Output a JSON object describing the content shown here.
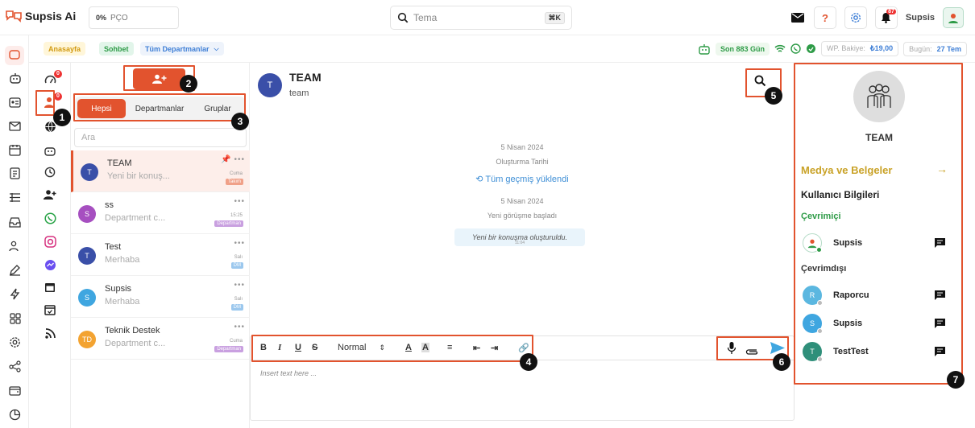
{
  "app": {
    "name": "Supsis Ai"
  },
  "top": {
    "progress_pct": "0%",
    "progress_label": "PÇO",
    "search_value": "Tema",
    "search_shortcut": "⌘K",
    "notif_count": "87",
    "user_name": "Supsis"
  },
  "subbar": {
    "home": "Anasayfa",
    "chat": "Sohbet",
    "dept_select": "Tüm Departmanlar",
    "days": "Son 883 Gün",
    "wp_label": "WP. Bakiye:",
    "wp_value": "₺19,00",
    "today_label": "Bugün:",
    "today_value": "27 Tem"
  },
  "nav_badges": {
    "a": "0",
    "b": "0"
  },
  "list": {
    "tabs": [
      "Hepsi",
      "Departmanlar",
      "Gruplar"
    ],
    "search_placeholder": "Ara",
    "conversations": [
      {
        "initial": "T",
        "name": "TEAM",
        "preview": "Yeni bir konuş...",
        "time": "Cuma",
        "tag": "Takım",
        "color": "#3a4fa8",
        "tag_color": "#f0a088",
        "selected": true
      },
      {
        "initial": "S",
        "name": "ss",
        "preview": "Department c...",
        "time": "15:25",
        "tag": "Departman",
        "color": "#a64fc0",
        "tag_color": "#c9a0e0"
      },
      {
        "initial": "T",
        "name": "Test",
        "preview": "Merhaba",
        "time": "Salı",
        "tag": "DM",
        "color": "#3a4fa8",
        "tag_color": "#9cc8ee"
      },
      {
        "initial": "S",
        "name": "Supsis",
        "preview": "Merhaba",
        "time": "Salı",
        "tag": "DM",
        "color": "#3fa6e0",
        "tag_color": "#9cc8ee"
      },
      {
        "initial": "TD",
        "name": "Teknik Destek",
        "preview": "Department c...",
        "time": "Cuma",
        "tag": "Departman",
        "color": "#f3a331",
        "tag_color": "#c9a0e0"
      }
    ]
  },
  "chat": {
    "initial": "T",
    "title": "TEAM",
    "subtitle": "team",
    "date1": "5 Nisan 2024",
    "created": "Oluşturma Tarihi",
    "history": "Tüm geçmiş yüklendi",
    "date2": "5 Nisan 2024",
    "started": "Yeni görüşme başladı",
    "bubble": "Yeni bir konuşma oluşturuldu.",
    "bubble_time": "11:04",
    "editor": {
      "style": "Normal",
      "placeholder": "Insert text here ..."
    }
  },
  "right": {
    "title": "TEAM",
    "media": "Medya ve Belgeler",
    "users": "Kullanıcı Bilgileri",
    "online": "Çevrimiçi",
    "offline": "Çevrimdışı",
    "online_users": [
      {
        "name": "Supsis"
      }
    ],
    "offline_users": [
      {
        "initial": "R",
        "name": "Raporcu",
        "color": "#5bb7e0"
      },
      {
        "initial": "S",
        "name": "Supsis",
        "color": "#3fa6e0"
      },
      {
        "initial": "T",
        "name": "TestTest",
        "color": "#2f8f7a"
      }
    ]
  },
  "annotations": [
    "1",
    "2",
    "3",
    "4",
    "5",
    "6",
    "7"
  ],
  "colors": {
    "accent": "#e2532e",
    "annotation": "#e2532e"
  }
}
